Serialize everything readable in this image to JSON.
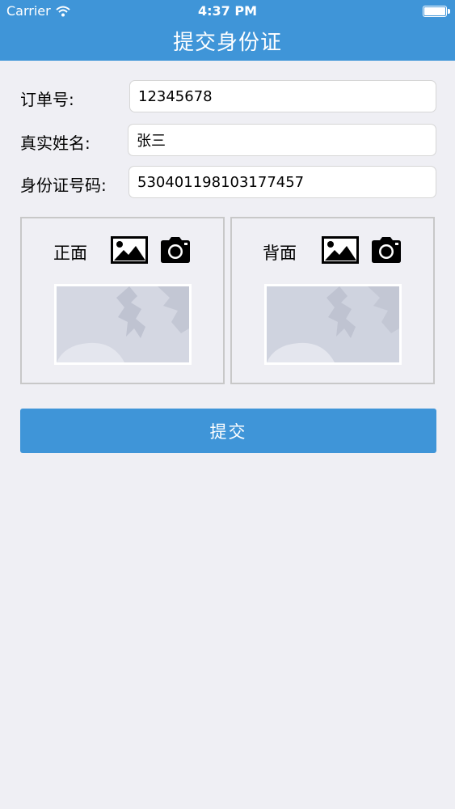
{
  "status_bar": {
    "carrier": "Carrier",
    "time": "4:37 PM",
    "battery_level": 1.0
  },
  "nav": {
    "title": "提交身份证"
  },
  "form": {
    "order_label": "订单号:",
    "order_value": "12345678",
    "name_label": "真实姓名:",
    "name_value": "张三",
    "id_label": "身份证号码:",
    "id_value": "530401198103177457"
  },
  "cards": {
    "front_label": "正面",
    "back_label": "背面"
  },
  "submit_label": "提交",
  "colors": {
    "accent": "#3f95d8",
    "background": "#efeff4"
  },
  "icons": [
    "wifi-icon",
    "battery-icon",
    "picture-icon",
    "camera-icon"
  ]
}
